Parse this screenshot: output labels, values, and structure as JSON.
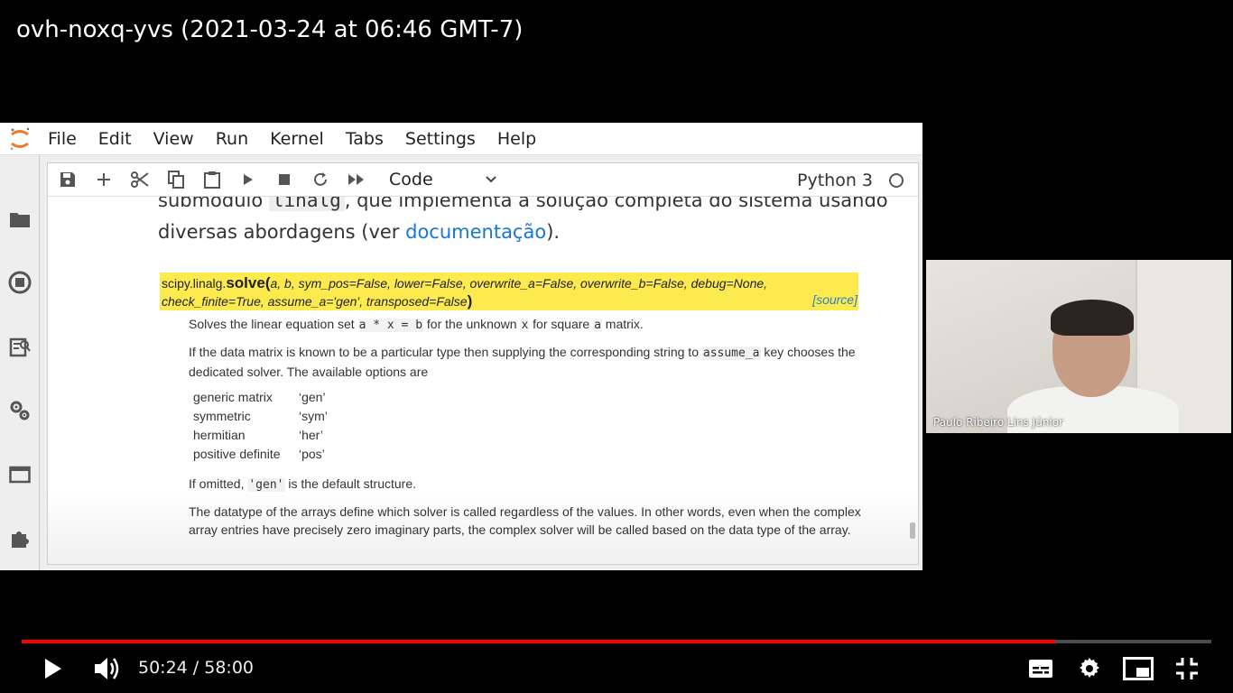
{
  "video": {
    "title": "ovh-noxq-yvs (2021-03-24 at 06:46 GMT-7)",
    "time_current": "50:24",
    "time_total": "58:00",
    "time_display": "50:24 / 58:00",
    "progress": 0.869,
    "accent_color": "#ff0000"
  },
  "menubar": {
    "items": [
      "File",
      "Edit",
      "View",
      "Run",
      "Kernel",
      "Tabs",
      "Settings",
      "Help"
    ]
  },
  "sidebar": {
    "icons": [
      "folder-icon",
      "running-icon",
      "commands-icon",
      "property-inspector-icon",
      "tabs-icon",
      "extension-icon"
    ]
  },
  "toolbar": {
    "cell_type": "Code",
    "kernel_name": "Python 3"
  },
  "markdown": {
    "line1_pre": "submódulo ",
    "line1_code": "linalg",
    "line1_post": ", que implementa a solução completa do sistema usando",
    "line2_pre": "diversas abordagens (ver ",
    "line2_link": "documentação",
    "line2_post": ")."
  },
  "doc": {
    "sig_module": "scipy.linalg.",
    "sig_function": "solve",
    "sig_params_line1": "a, b, sym_pos=False, lower=False, overwrite_a=False, overwrite_b=False, debug=None,",
    "sig_params_line2": "check_finite=True, assume_a='gen', transposed=False",
    "source_link": "[source]",
    "summary_pre": "Solves the linear equation set ",
    "summary_code1": "a * x = b",
    "summary_mid": " for the unknown ",
    "summary_code2": "x",
    "summary_mid2": " for square ",
    "summary_code3": "a",
    "summary_post": " matrix.",
    "para2_pre": "If the data matrix is known to be a particular type then supplying the corresponding string to ",
    "para2_code": "assume_a",
    "para2_post": " key chooses the dedicated solver. The available options are",
    "options": [
      {
        "name": "generic matrix",
        "value": "‘gen’"
      },
      {
        "name": "symmetric",
        "value": "‘sym’"
      },
      {
        "name": "hermitian",
        "value": "‘her’"
      },
      {
        "name": "positive definite",
        "value": "‘pos’"
      }
    ],
    "omitted_pre": "If omitted, ",
    "omitted_code": "'gen'",
    "omitted_post": " is the default structure.",
    "para3": "The datatype of the arrays define which solver is called regardless of the values. In other words, even when the complex array entries have precisely zero imaginary parts, the complex solver will be called based on the data type of the array."
  },
  "webcam": {
    "name": "Paulo Ribeiro Lins Júnior"
  }
}
